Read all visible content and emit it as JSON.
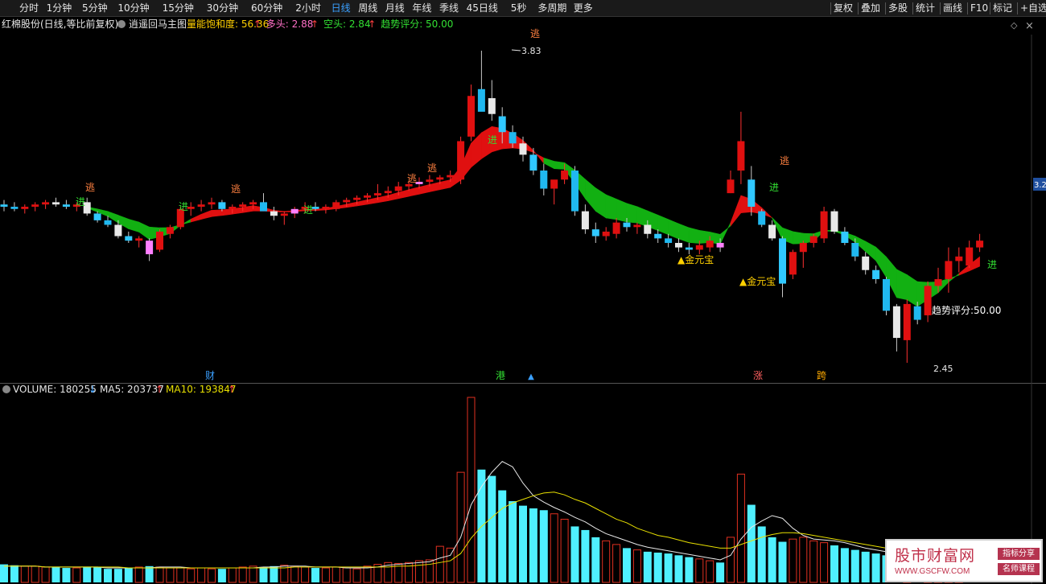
{
  "toolbar": {
    "left": [
      "分时",
      "1分钟",
      "5分钟",
      "10分钟",
      "15分钟",
      "30分钟",
      "60分钟",
      "2小时",
      "日线",
      "周线",
      "月线",
      "年线",
      "季线",
      "45日线",
      "5秒",
      "多周期",
      "更多"
    ],
    "active": "日线",
    "right": [
      "复权",
      "叠加",
      "多股",
      "统计",
      "画线",
      "F10",
      "标记",
      "+自选"
    ]
  },
  "legend": {
    "title": "红棉股份(日线,等比前复权)",
    "indicator": "逍遥回马主图",
    "items": [
      {
        "label": "量能饱和度: 56.36",
        "arrow": "↑",
        "color": "#ffd000"
      },
      {
        "label": "多头: 2.88",
        "arrow": "↑",
        "color": "#ff6fc7"
      },
      {
        "label": "空头: 2.84",
        "arrow": "↑",
        "color": "#33e033"
      },
      {
        "label": "趋势评分: 50.00",
        "arrow": "",
        "color": "#33e033"
      }
    ]
  },
  "price_axis_label": "3.2",
  "annotations": {
    "high": "3.83",
    "low": "2.45",
    "score": "趋势评分:50.00",
    "gold1": "▲金元宝",
    "gold2": "▲金元宝",
    "escape": "逃",
    "enter": "进",
    "markers": [
      "财",
      "港",
      "涨",
      "跨"
    ]
  },
  "volume_legend": {
    "volume": "VOLUME: 180255",
    "volume_arrow": "↓",
    "ma5": "MA5: 203737",
    "ma5_arrow": "↑",
    "ma10": "MA10: 193847",
    "ma10_arrow": "↑"
  },
  "chart_data": {
    "type": "bar",
    "ohlc": [
      [
        3.15,
        3.17,
        3.12,
        3.14
      ],
      [
        3.14,
        3.16,
        3.12,
        3.13
      ],
      [
        3.13,
        3.15,
        3.11,
        3.14
      ],
      [
        3.14,
        3.16,
        3.12,
        3.15
      ],
      [
        3.15,
        3.17,
        3.13,
        3.16
      ],
      [
        3.16,
        3.18,
        3.14,
        3.15
      ],
      [
        3.15,
        3.17,
        3.13,
        3.14
      ],
      [
        3.14,
        3.16,
        3.12,
        3.15
      ],
      [
        3.16,
        3.18,
        3.1,
        3.11
      ],
      [
        3.11,
        3.12,
        3.07,
        3.08
      ],
      [
        3.08,
        3.1,
        3.05,
        3.06
      ],
      [
        3.06,
        3.08,
        3.0,
        3.01
      ],
      [
        3.01,
        3.03,
        2.98,
        2.99
      ],
      [
        2.99,
        3.01,
        2.96,
        3.0
      ],
      [
        2.99,
        3.0,
        2.9,
        2.93
      ],
      [
        2.95,
        3.04,
        2.94,
        3.03
      ],
      [
        3.02,
        3.06,
        3.0,
        3.05
      ],
      [
        3.05,
        3.14,
        3.04,
        3.13
      ],
      [
        3.13,
        3.16,
        3.1,
        3.14
      ],
      [
        3.14,
        3.17,
        3.12,
        3.15
      ],
      [
        3.15,
        3.18,
        3.13,
        3.16
      ],
      [
        3.16,
        3.17,
        3.12,
        3.13
      ],
      [
        3.13,
        3.15,
        3.11,
        3.14
      ],
      [
        3.14,
        3.16,
        3.12,
        3.15
      ],
      [
        3.15,
        3.17,
        3.13,
        3.16
      ],
      [
        3.16,
        3.2,
        3.14,
        3.12
      ],
      [
        3.12,
        3.14,
        3.08,
        3.1
      ],
      [
        3.1,
        3.12,
        3.06,
        3.11
      ],
      [
        3.11,
        3.14,
        3.09,
        3.13
      ],
      [
        3.13,
        3.16,
        3.11,
        3.14
      ],
      [
        3.14,
        3.16,
        3.12,
        3.13
      ],
      [
        3.13,
        3.15,
        3.11,
        3.14
      ],
      [
        3.13,
        3.17,
        3.12,
        3.16
      ],
      [
        3.16,
        3.18,
        3.14,
        3.17
      ],
      [
        3.17,
        3.19,
        3.15,
        3.18
      ],
      [
        3.18,
        3.2,
        3.16,
        3.19
      ],
      [
        3.19,
        3.24,
        3.17,
        3.2
      ],
      [
        3.2,
        3.23,
        3.18,
        3.21
      ],
      [
        3.21,
        3.25,
        3.19,
        3.23
      ],
      [
        3.23,
        3.25,
        3.21,
        3.24
      ],
      [
        3.24,
        3.27,
        3.22,
        3.25
      ],
      [
        3.25,
        3.28,
        3.23,
        3.26
      ],
      [
        3.26,
        3.28,
        3.24,
        3.27
      ],
      [
        3.27,
        3.3,
        3.25,
        3.28
      ],
      [
        3.26,
        3.45,
        3.24,
        3.43
      ],
      [
        3.45,
        3.68,
        3.43,
        3.63
      ],
      [
        3.66,
        3.83,
        3.6,
        3.56
      ],
      [
        3.62,
        3.7,
        3.52,
        3.55
      ],
      [
        3.54,
        3.58,
        3.42,
        3.47
      ],
      [
        3.47,
        3.5,
        3.4,
        3.42
      ],
      [
        3.42,
        3.45,
        3.34,
        3.37
      ],
      [
        3.37,
        3.4,
        3.28,
        3.3
      ],
      [
        3.3,
        3.33,
        3.19,
        3.22
      ],
      [
        3.22,
        3.24,
        3.15,
        3.26
      ],
      [
        3.26,
        3.33,
        3.24,
        3.3
      ],
      [
        3.3,
        3.32,
        3.1,
        3.12
      ],
      [
        3.12,
        3.15,
        3.02,
        3.04
      ],
      [
        3.04,
        3.07,
        2.98,
        3.01
      ],
      [
        3.01,
        3.05,
        2.99,
        3.03
      ],
      [
        3.02,
        3.09,
        3.0,
        3.07
      ],
      [
        3.07,
        3.09,
        3.03,
        3.05
      ],
      [
        3.05,
        3.07,
        3.02,
        3.06
      ],
      [
        3.06,
        3.08,
        3.0,
        3.02
      ],
      [
        3.02,
        3.04,
        2.98,
        3.0
      ],
      [
        3.0,
        3.02,
        2.96,
        2.98
      ],
      [
        2.98,
        3.0,
        2.94,
        2.96
      ],
      [
        2.96,
        2.98,
        2.93,
        2.95
      ],
      [
        2.95,
        2.99,
        2.93,
        2.97
      ],
      [
        2.96,
        3.01,
        2.94,
        2.99
      ],
      [
        2.98,
        3.0,
        2.94,
        2.96
      ],
      [
        3.2,
        3.3,
        3.2,
        3.26
      ],
      [
        3.3,
        3.56,
        3.24,
        3.43
      ],
      [
        3.26,
        3.32,
        3.1,
        3.14
      ],
      [
        3.12,
        3.13,
        3.05,
        3.06
      ],
      [
        3.06,
        3.08,
        2.99,
        3.0
      ],
      [
        3.0,
        3.01,
        2.74,
        2.8
      ],
      [
        2.84,
        2.95,
        2.82,
        2.94
      ],
      [
        2.94,
        2.99,
        2.87,
        2.98
      ],
      [
        2.98,
        3.02,
        2.96,
        3.01
      ],
      [
        3.0,
        3.14,
        2.98,
        3.12
      ],
      [
        3.12,
        3.13,
        3.02,
        3.03
      ],
      [
        3.03,
        3.05,
        2.97,
        2.98
      ],
      [
        2.98,
        3.0,
        2.9,
        2.92
      ],
      [
        2.92,
        2.94,
        2.84,
        2.86
      ],
      [
        2.86,
        2.88,
        2.8,
        2.82
      ],
      [
        2.82,
        2.83,
        2.66,
        2.68
      ],
      [
        2.7,
        2.71,
        2.5,
        2.56
      ],
      [
        2.55,
        2.73,
        2.45,
        2.71
      ],
      [
        2.7,
        2.72,
        2.62,
        2.64
      ],
      [
        2.66,
        2.81,
        2.63,
        2.79
      ],
      [
        2.79,
        2.87,
        2.76,
        2.82
      ],
      [
        2.82,
        2.96,
        2.76,
        2.9
      ],
      [
        2.9,
        2.96,
        2.85,
        2.92
      ],
      [
        2.88,
        2.99,
        2.87,
        2.96
      ],
      [
        2.96,
        3.02,
        2.94,
        2.99
      ]
    ],
    "volume": [
      20,
      19,
      18,
      18,
      17,
      17,
      16,
      16,
      17,
      17,
      15,
      15,
      16,
      17,
      18,
      17,
      16,
      16,
      15,
      16,
      15,
      15,
      16,
      17,
      18,
      17,
      18,
      19,
      18,
      17,
      16,
      16,
      17,
      16,
      15,
      18,
      20,
      22,
      21,
      22,
      24,
      25,
      40,
      38,
      122,
      205,
      125,
      118,
      102,
      90,
      85,
      82,
      80,
      76,
      70,
      62,
      58,
      50,
      46,
      42,
      38,
      36,
      34,
      33,
      32,
      30,
      28,
      26,
      24,
      22,
      50,
      120,
      86,
      62,
      50,
      45,
      48,
      50,
      46,
      44,
      41,
      38,
      36,
      34,
      32,
      30,
      28,
      27,
      26,
      25,
      24,
      23,
      22
    ],
    "ma5": [
      18,
      18,
      18,
      18,
      17,
      17,
      17,
      17,
      17,
      17,
      16,
      16,
      16,
      16,
      16,
      17,
      17,
      17,
      16,
      16,
      16,
      16,
      16,
      16,
      16,
      17,
      17,
      18,
      18,
      18,
      17,
      17,
      17,
      16,
      16,
      16,
      17,
      19,
      20,
      21,
      22,
      23,
      27,
      30,
      50,
      86,
      106,
      122,
      134,
      128,
      110,
      96,
      89,
      83,
      78,
      72,
      67,
      60,
      54,
      50,
      46,
      42,
      39,
      37,
      35,
      33,
      31,
      29,
      27,
      25,
      30,
      48,
      61,
      68,
      74,
      71,
      60,
      52,
      48,
      47,
      46,
      44,
      41,
      38,
      36,
      34,
      32,
      30,
      28,
      27,
      26,
      25,
      24
    ],
    "ma10": [
      18,
      18,
      18,
      18,
      17,
      17,
      17,
      17,
      17,
      17,
      17,
      17,
      16,
      16,
      16,
      16,
      16,
      16,
      16,
      16,
      16,
      16,
      16,
      16,
      16,
      16,
      16,
      16,
      17,
      17,
      17,
      17,
      17,
      17,
      17,
      17,
      17,
      17,
      18,
      18,
      19,
      20,
      22,
      24,
      32,
      49,
      62,
      72,
      82,
      88,
      92,
      96,
      99,
      100,
      97,
      92,
      88,
      82,
      76,
      70,
      66,
      60,
      56,
      52,
      50,
      47,
      44,
      42,
      40,
      38,
      38,
      42,
      46,
      50,
      53,
      55,
      55,
      54,
      52,
      50,
      48,
      46,
      44,
      42,
      40,
      38,
      36,
      34,
      32,
      31,
      30,
      29,
      28
    ],
    "price_range": [
      2.45,
      3.83
    ],
    "grid": false
  }
}
